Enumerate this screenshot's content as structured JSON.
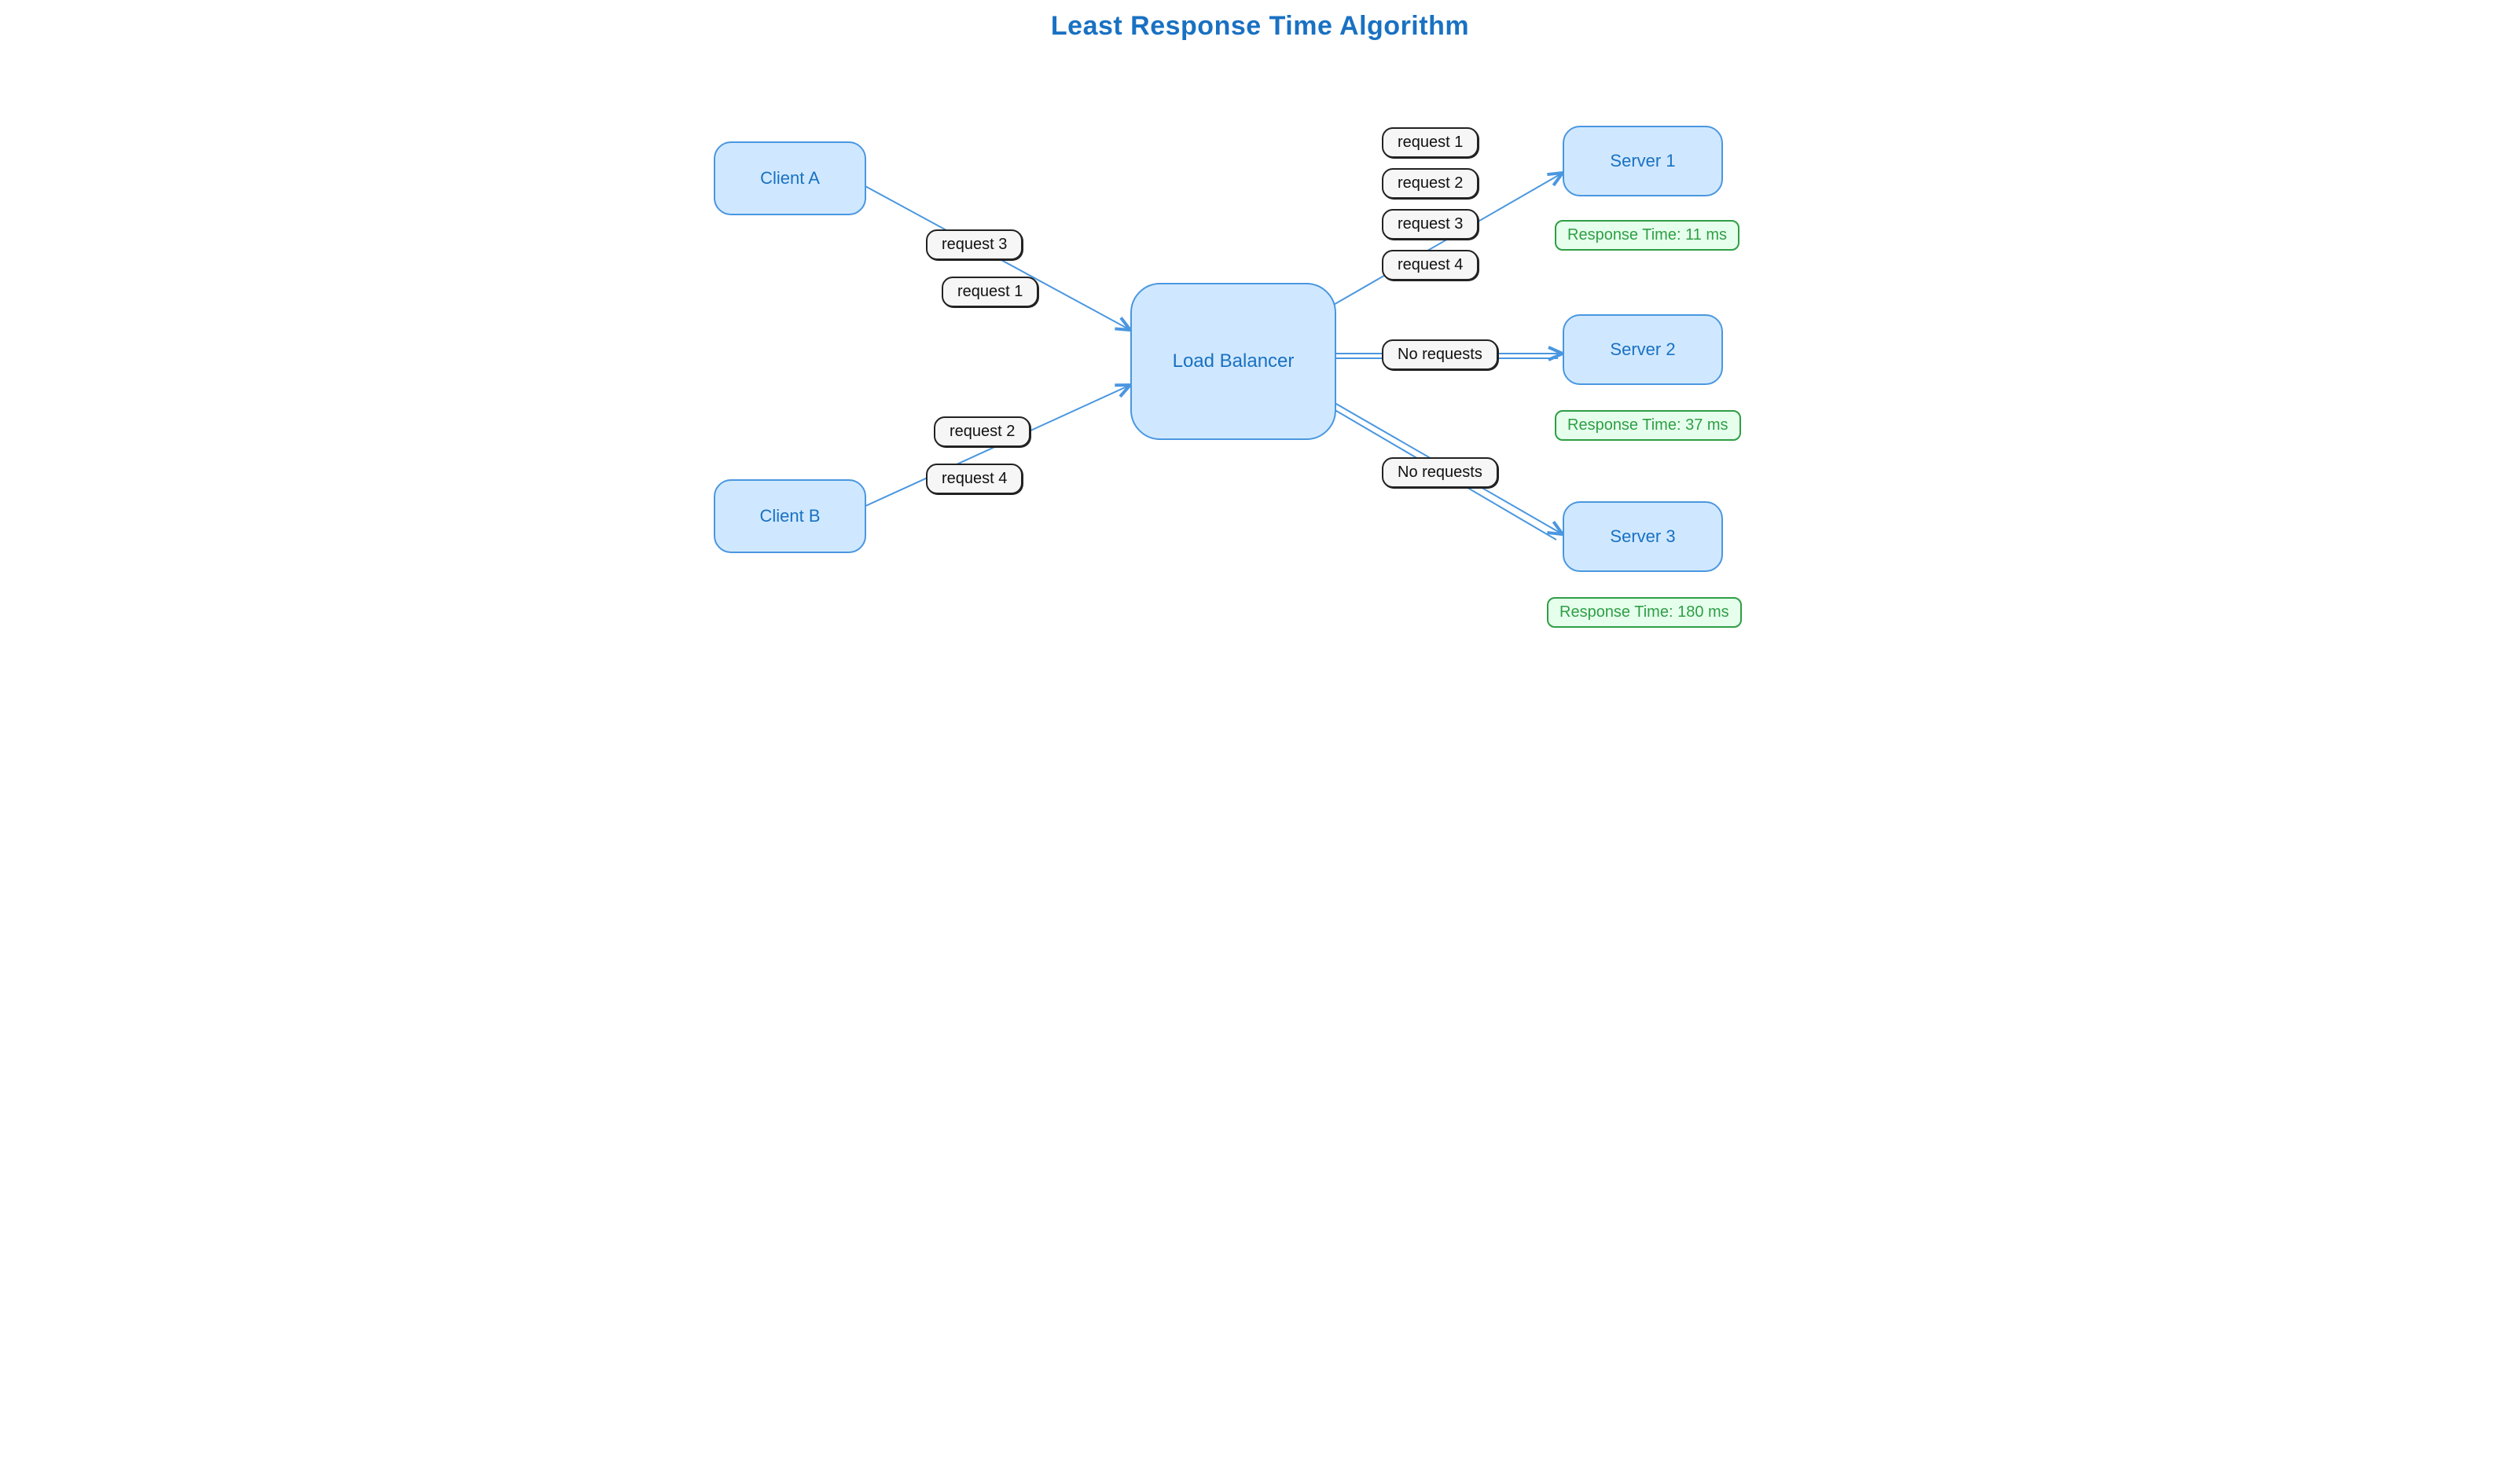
{
  "title": "Least Response Time Algorithm",
  "clients": {
    "a": {
      "label": "Client A",
      "requests": [
        "request 3",
        "request 1"
      ]
    },
    "b": {
      "label": "Client B",
      "requests": [
        "request 2",
        "request 4"
      ]
    }
  },
  "balancer": {
    "label": "Load Balancer"
  },
  "servers": {
    "s1": {
      "label": "Server 1",
      "requests": [
        "request 1",
        "request 2",
        "request 3",
        "request 4"
      ],
      "response_time": "Response Time: 11 ms"
    },
    "s2": {
      "label": "Server 2",
      "requests_label": "No requests",
      "response_time": "Response Time: 37 ms"
    },
    "s3": {
      "label": "Server 3",
      "requests_label": "No requests",
      "response_time": "Response Time: 180 ms"
    }
  }
}
